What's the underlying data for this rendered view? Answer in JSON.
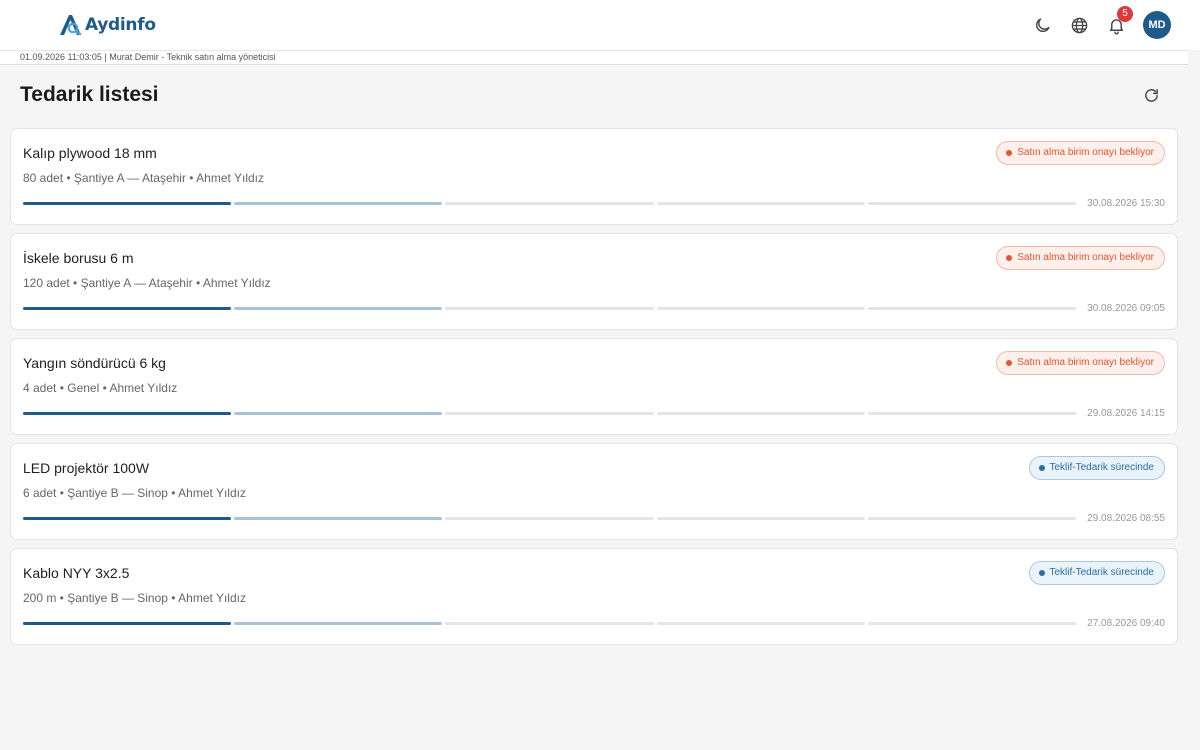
{
  "brand": {
    "name": "Aydinfo"
  },
  "header": {
    "notification_count": "5",
    "avatar_initials": "MD",
    "icons": [
      "moon-icon",
      "globe-icon",
      "bell-icon"
    ]
  },
  "subbar": {
    "text": "01.09.2026 11:03:05 | Murat Demir - Teknik satın alma yöneticisi"
  },
  "page": {
    "title": "Tedarik listesi"
  },
  "colors": {
    "brand": "#1f5b8a",
    "pending": "#e5562e",
    "quote": "#2a6e9e",
    "badge": "#e0373a"
  },
  "items": [
    {
      "title": "Kalıp plywood 18 mm",
      "meta": "80 adet • Şantiye A — Ataşehir • Ahmet Yıldız",
      "status": "Satın alma birim onayı bekliyor",
      "status_type": "pending",
      "date": "30.08.2026 15:30",
      "progress_steps": 5,
      "progress_done": 1,
      "progress_active": 2
    },
    {
      "title": "İskele borusu 6 m",
      "meta": "120 adet • Şantiye A — Ataşehir • Ahmet Yıldız",
      "status": "Satın alma birim onayı bekliyor",
      "status_type": "pending",
      "date": "30.08.2026 09:05",
      "progress_steps": 5,
      "progress_done": 1,
      "progress_active": 2
    },
    {
      "title": "Yangın söndürücü 6 kg",
      "meta": "4 adet • Genel • Ahmet Yıldız",
      "status": "Satın alma birim onayı bekliyor",
      "status_type": "pending",
      "date": "29.08.2026 14:15",
      "progress_steps": 5,
      "progress_done": 1,
      "progress_active": 2
    },
    {
      "title": "LED projektör 100W",
      "meta": "6 adet • Şantiye B — Sinop • Ahmet Yıldız",
      "status": "Teklif-Tedarik sürecinde",
      "status_type": "quote",
      "date": "29.08.2026 08:55",
      "progress_steps": 5,
      "progress_done": 1,
      "progress_active": 2
    },
    {
      "title": "Kablo NYY 3x2.5",
      "meta": "200 m • Şantiye B — Sinop • Ahmet Yıldız",
      "status": "Teklif-Tedarik sürecinde",
      "status_type": "quote",
      "date": "27.08.2026 09:40",
      "progress_steps": 5,
      "progress_done": 1,
      "progress_active": 2
    }
  ]
}
